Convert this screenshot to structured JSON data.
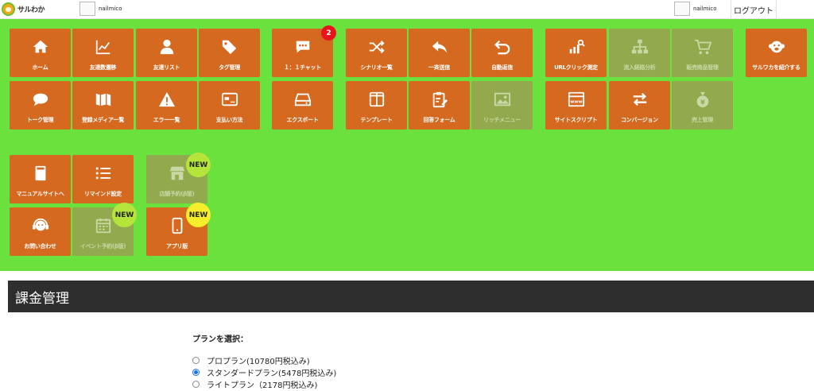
{
  "header": {
    "logo_text": "サルわか",
    "account_left": "nailmico",
    "account_right": "nailmico",
    "logout_label": "ログアウト"
  },
  "menu": {
    "home": "ホーム",
    "friend_trend": "友達数遷移",
    "friend_list": "友達リスト",
    "tag_manage": "タグ管理",
    "talk_manage": "トーク管理",
    "media": "登録メディア一覧",
    "errors": "エラー一覧",
    "payment": "支払い方法",
    "chat": "１：１チャット",
    "chat_badge": "2",
    "export": "エクスポート",
    "scenario": "シナリオ一覧",
    "broadcast": "一斉送信",
    "auto_reply": "自動返信",
    "template": "テンプレート",
    "answer_form": "回答フォーム",
    "rich_menu": "リッチメニュー",
    "url_click": "URLクリック測定",
    "inflow": "流入経路分析",
    "products": "販売商品管理",
    "site_script": "サイトスクリプト",
    "conversion": "コンバージョン",
    "sales": "売上管理",
    "introduce": "サルワカを紹介する",
    "manual": "マニュアルサイトへ",
    "remind": "リマインド設定",
    "store_reserve": "店舗予約(β版)",
    "store_reserve_badge": "NEW",
    "contact": "お問い合わせ",
    "event_reserve": "イベント予約(β版)",
    "event_reserve_badge": "NEW",
    "app": "アプリ版",
    "app_badge": "NEW"
  },
  "billing": {
    "section_title": "課金管理",
    "select_label": "プランを選択：",
    "plans": [
      {
        "label": "プロプラン(10780円税込み)",
        "selected": false
      },
      {
        "label": "スタンダードプラン(5478円税込み)",
        "selected": true
      },
      {
        "label": "ライトプラン（2178円税込み)",
        "selected": false
      }
    ]
  },
  "colors": {
    "menu_bg": "#6ae13d",
    "tile_active": "#d4691f",
    "tile_disabled": "#93a94e",
    "badge_red": "#e8141c",
    "section_bar": "#2e2e2e"
  }
}
